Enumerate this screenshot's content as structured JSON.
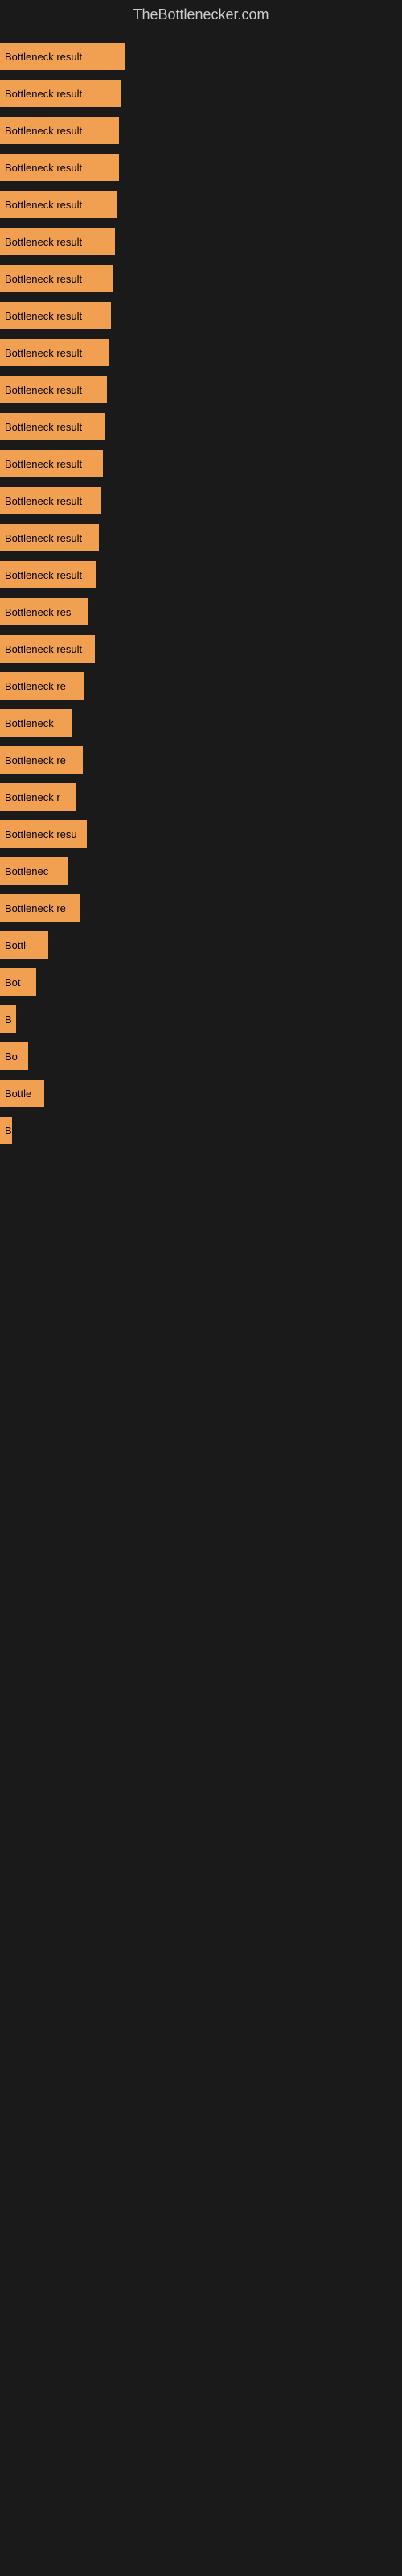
{
  "header": {
    "title": "TheBottlenecker.com"
  },
  "bars": [
    {
      "label": "Bottleneck result",
      "width": 155
    },
    {
      "label": "Bottleneck result",
      "width": 150
    },
    {
      "label": "Bottleneck result",
      "width": 148
    },
    {
      "label": "Bottleneck result",
      "width": 148
    },
    {
      "label": "Bottleneck result",
      "width": 145
    },
    {
      "label": "Bottleneck result",
      "width": 143
    },
    {
      "label": "Bottleneck result",
      "width": 140
    },
    {
      "label": "Bottleneck result",
      "width": 138
    },
    {
      "label": "Bottleneck result",
      "width": 135
    },
    {
      "label": "Bottleneck result",
      "width": 133
    },
    {
      "label": "Bottleneck result",
      "width": 130
    },
    {
      "label": "Bottleneck result",
      "width": 128
    },
    {
      "label": "Bottleneck result",
      "width": 125
    },
    {
      "label": "Bottleneck result",
      "width": 123
    },
    {
      "label": "Bottleneck result",
      "width": 120
    },
    {
      "label": "Bottleneck res",
      "width": 110
    },
    {
      "label": "Bottleneck result",
      "width": 118
    },
    {
      "label": "Bottleneck re",
      "width": 105
    },
    {
      "label": "Bottleneck",
      "width": 90
    },
    {
      "label": "Bottleneck re",
      "width": 103
    },
    {
      "label": "Bottleneck r",
      "width": 95
    },
    {
      "label": "Bottleneck resu",
      "width": 108
    },
    {
      "label": "Bottlenec",
      "width": 85
    },
    {
      "label": "Bottleneck re",
      "width": 100
    },
    {
      "label": "Bottl",
      "width": 60
    },
    {
      "label": "Bot",
      "width": 45
    },
    {
      "label": "B",
      "width": 20
    },
    {
      "label": "Bo",
      "width": 35
    },
    {
      "label": "Bottle",
      "width": 55
    },
    {
      "label": "B",
      "width": 15
    }
  ]
}
